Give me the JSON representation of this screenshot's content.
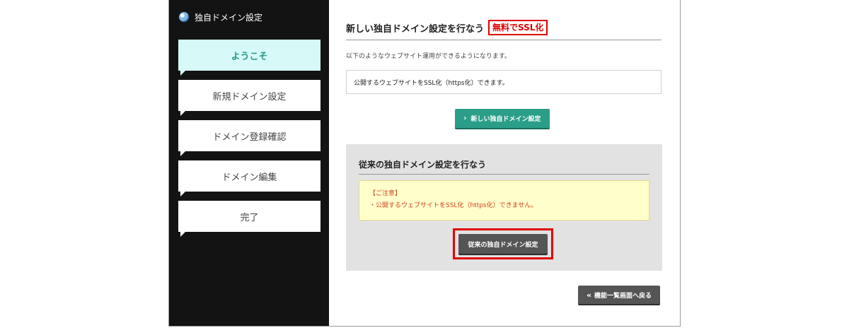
{
  "sidebar": {
    "title": "独自ドメイン設定",
    "steps": [
      {
        "label": "ようこそ"
      },
      {
        "label": "新規ドメイン設定"
      },
      {
        "label": "ドメイン登録確認"
      },
      {
        "label": "ドメイン編集"
      },
      {
        "label": "完了"
      }
    ]
  },
  "main": {
    "heading": "新しい独自ドメイン設定を行なう",
    "ssl_badge": "無料でSSL化",
    "intro": "以下のようなウェブサイト運用ができるようになります。",
    "info": "公開するウェブサイトをSSL化（https化）できます。",
    "new_button": "新しい独自ドメイン設定",
    "legacy": {
      "title": "従来の独自ドメイン設定を行なう",
      "notice_title": "【ご注意】",
      "notice_body": "・公開するウェブサイトをSSL化（https化）できません。",
      "button": "従来の独自ドメイン設定"
    },
    "back_button": "機能一覧画面へ戻る"
  },
  "colors": {
    "accent_green": "#2a9e88",
    "active_step_bg": "#d7faf9",
    "highlight_red": "#e00000",
    "notice_bg": "#ffffcc"
  }
}
